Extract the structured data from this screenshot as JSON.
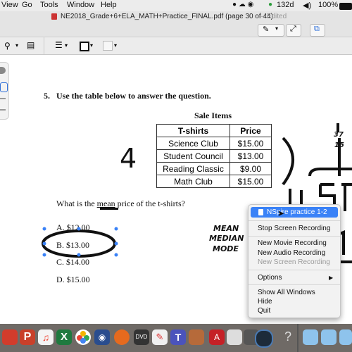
{
  "menubar": {
    "items": [
      "View",
      "Go",
      "Tools",
      "Window",
      "Help"
    ],
    "status": {
      "temp": "132d",
      "battery": "100%"
    }
  },
  "window": {
    "title": "NE2018_Grade+6+ELA_MATH+Practice_FINAL.pdf (page 30 of 44)",
    "edited": "— Edited"
  },
  "question": {
    "number": "5.",
    "prompt": "Use the table below to answer the question.",
    "table_title": "Sale Items",
    "headers": [
      "T-shirts",
      "Price"
    ],
    "rows": [
      [
        "Science Club",
        "$15.00"
      ],
      [
        "Student Council",
        "$13.00"
      ],
      [
        "Reading Classic",
        "$9.00"
      ],
      [
        "Math Club",
        "$15.00"
      ]
    ],
    "ask": "What is the mean price of the t-shirts?",
    "ask_parts": {
      "before": "What is the ",
      "mean": "mean",
      "after": " price of the t-shirts?"
    },
    "choices": [
      {
        "letter": "A.",
        "value": "$12.00"
      },
      {
        "letter": "B.",
        "value": "$13.00"
      },
      {
        "letter": "C.",
        "value": "$14.00"
      },
      {
        "letter": "D.",
        "value": "$15.00"
      }
    ]
  },
  "handwriting": {
    "count": "4",
    "side": [
      "37",
      "15"
    ],
    "words": [
      "MEAN",
      "MEDIAN",
      "MODE"
    ]
  },
  "context_menu": {
    "items": [
      {
        "label": "NSpire practice 1-2",
        "highlighted": true
      },
      {
        "label": "Stop Screen Recording"
      },
      {
        "label": "New Movie Recording"
      },
      {
        "label": "New Audio Recording"
      },
      {
        "label": "New Screen Recording",
        "disabled": true
      },
      {
        "label": "Options",
        "submenu": true
      },
      {
        "label": "Show All Windows"
      },
      {
        "label": "Hide"
      },
      {
        "label": "Quit"
      }
    ]
  }
}
